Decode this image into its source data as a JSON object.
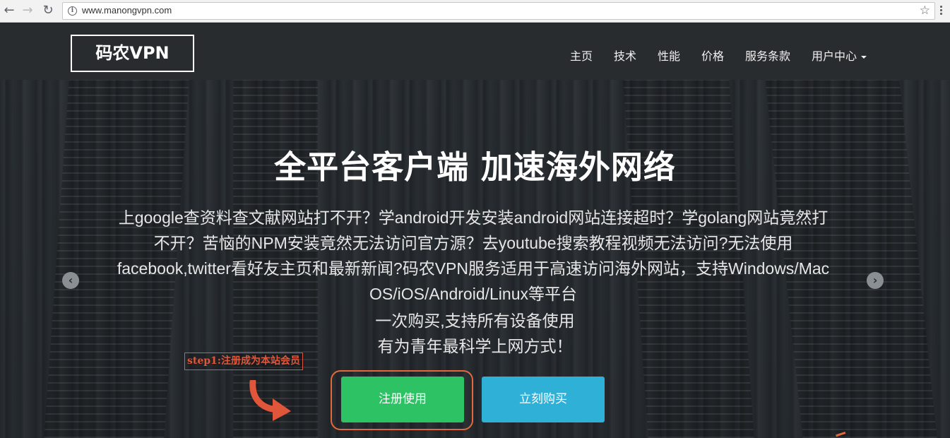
{
  "browser": {
    "url": "www.manongvpn.com",
    "back_glyph": "←",
    "forward_glyph": "→",
    "reload_glyph": "↻",
    "info_glyph": "i",
    "star_glyph": "☆"
  },
  "header": {
    "logo": "码农VPN",
    "nav": [
      "主页",
      "技术",
      "性能",
      "价格",
      "服务条款",
      "用户中心"
    ]
  },
  "hero": {
    "title": "全平台客户端 加速海外网络",
    "description": "上google查资料查文献网站打不开？学android开发安装android网站连接超时？学golang网站竟然打不开？苦恼的NPM安装竟然无法访问官方源？去youtube搜索教程视频无法访问?无法使用facebook,twitter看好友主页和最新新闻?码农VPN服务适用于高速访问海外网站，支持Windows/Mac OS/iOS/Android/Linux等平台",
    "line_a": "一次购买,支持所有设备使用",
    "line_b": "有为青年最科学上网方式！",
    "prev_glyph": "‹",
    "next_glyph": "›"
  },
  "annotation": {
    "step_label": "step1:注册成为本站会员",
    "accent_color": "#e0563a"
  },
  "buttons": {
    "register": "注册使用",
    "buy": "立刻购买",
    "register_color": "#2dc365",
    "buy_color": "#2fb0d7"
  }
}
